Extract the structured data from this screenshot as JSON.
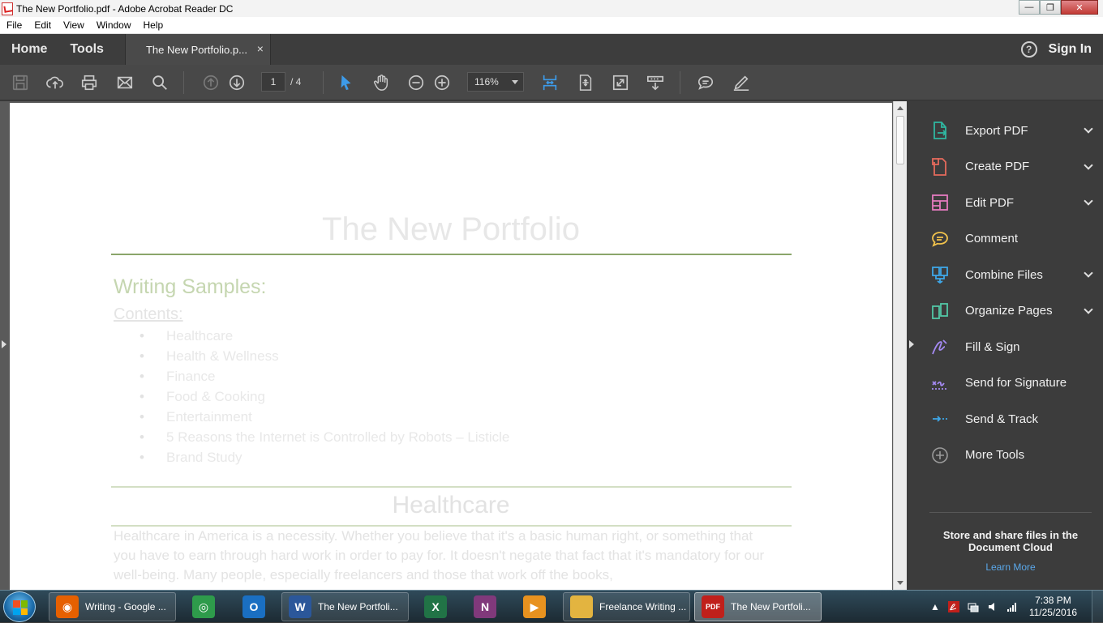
{
  "window": {
    "title": "The New Portfolio.pdf - Adobe Acrobat Reader DC",
    "minimize": "—",
    "maximize": "❐",
    "close": "✕"
  },
  "menu": [
    "File",
    "Edit",
    "View",
    "Window",
    "Help"
  ],
  "nav": {
    "home": "Home",
    "tools": "Tools",
    "doc_tab": "The New Portfolio.p...",
    "tab_close": "×",
    "help": "?",
    "sign_in": "Sign In"
  },
  "toolbar": {
    "page_current": "1",
    "page_total": "/ 4",
    "zoom": "116%"
  },
  "document": {
    "title": "The New Portfolio",
    "section": "Writing Samples:",
    "contents_label": "Contents:",
    "toc": [
      "Healthcare",
      "Health & Wellness",
      "Finance",
      "Food & Cooking",
      "Entertainment",
      "5 Reasons the Internet is Controlled by Robots – Listicle",
      "Brand Study"
    ],
    "heading2": "Healthcare",
    "body": "Healthcare in America is a necessity. Whether you believe that it's a basic human right, or something that you have to earn through hard work in order to pay for. It doesn't negate that fact that it's mandatory for our well-being. Many people, especially freelancers and those that work off the books,",
    "colors": {
      "rule_dark": "#8aa56a",
      "rule_light": "#d3dfc4"
    }
  },
  "tools_pane": {
    "items": [
      {
        "label": "Export PDF",
        "icon": "export-pdf-icon",
        "color": "#2fb7a1",
        "chevron": true
      },
      {
        "label": "Create PDF",
        "icon": "create-pdf-icon",
        "color": "#e46a5c",
        "chevron": true
      },
      {
        "label": "Edit PDF",
        "icon": "edit-pdf-icon",
        "color": "#e57abf",
        "chevron": true
      },
      {
        "label": "Comment",
        "icon": "comment-icon",
        "color": "#f2c34c",
        "chevron": false
      },
      {
        "label": "Combine Files",
        "icon": "combine-files-icon",
        "color": "#3ea7e8",
        "chevron": true
      },
      {
        "label": "Organize Pages",
        "icon": "organize-pages-icon",
        "color": "#52c7a6",
        "chevron": true
      },
      {
        "label": "Fill & Sign",
        "icon": "fill-sign-icon",
        "color": "#a58af3",
        "chevron": false
      },
      {
        "label": "Send for Signature",
        "icon": "send-signature-icon",
        "color": "#a58af3",
        "chevron": false
      },
      {
        "label": "Send & Track",
        "icon": "send-track-icon",
        "color": "#3ea7e8",
        "chevron": false
      },
      {
        "label": "More Tools",
        "icon": "more-tools-icon",
        "color": "#9a9a9a",
        "chevron": false
      }
    ],
    "cloud_text": "Store and share files in the Document Cloud",
    "learn_more": "Learn More"
  },
  "taskbar": {
    "tasks": [
      {
        "label": "Writing - Google ...",
        "icon": "firefox-icon",
        "color": "#e66000"
      },
      {
        "label": "",
        "icon": "chrome-icon",
        "color": "#2e9b4b"
      },
      {
        "label": "",
        "icon": "outlook-icon",
        "color": "#1a6fc2"
      },
      {
        "label": "The New Portfoli...",
        "icon": "word-icon",
        "color": "#2b579a"
      },
      {
        "label": "",
        "icon": "excel-icon",
        "color": "#217346"
      },
      {
        "label": "",
        "icon": "onenote-icon",
        "color": "#80397b"
      },
      {
        "label": "",
        "icon": "media-player-icon",
        "color": "#e8921f"
      },
      {
        "label": "Freelance Writing ...",
        "icon": "folder-icon",
        "color": "#e3b440"
      },
      {
        "label": "The New Portfoli...",
        "icon": "acrobat-icon",
        "color": "#c0201b"
      }
    ],
    "time": "7:38 PM",
    "date": "11/25/2016"
  }
}
